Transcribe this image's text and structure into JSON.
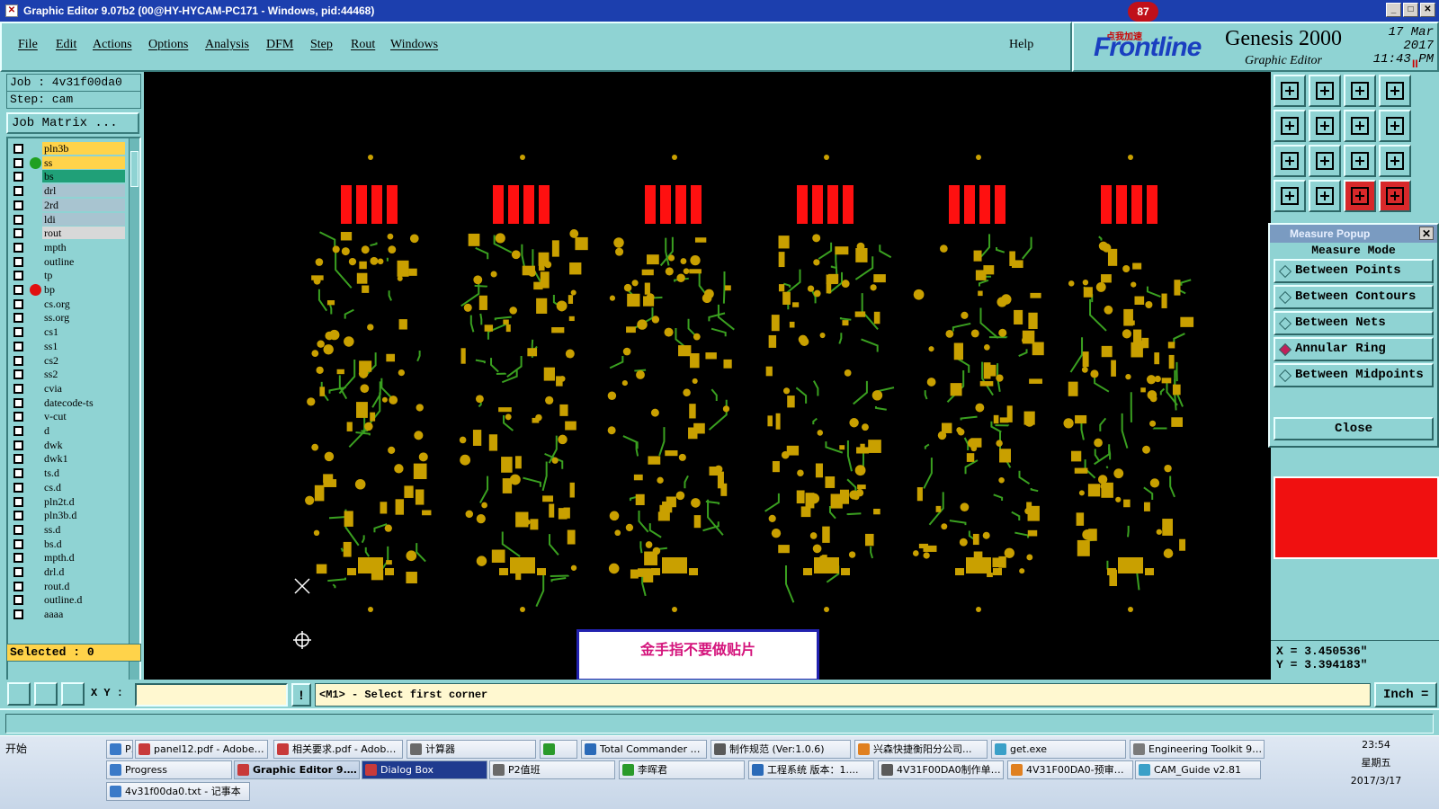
{
  "window": {
    "title": "Graphic Editor 9.07b2 (00@HY-HYCAM-PC171 - Windows, pid:44468)",
    "min": "_",
    "max": "□",
    "close": "✕"
  },
  "menu": [
    "File",
    "Edit",
    "Actions",
    "Options",
    "Analysis",
    "DFM",
    "Step",
    "Rout",
    "Windows"
  ],
  "help": "Help",
  "brand": {
    "logo": "Frontline",
    "product": "Genesis 2000",
    "subtitle": "Graphic Editor",
    "date": "17 Mar 2017",
    "time": "11:43 PM",
    "badge": "87",
    "badge_text": "点我加速",
    "pause": "II"
  },
  "job": {
    "job_line": "Job  :  4v31f00da0",
    "step_line": "Step:  cam"
  },
  "job_matrix": "Job Matrix ...",
  "layers": [
    {
      "name": "pln3b",
      "bg": "#ffd34a",
      "dot": ""
    },
    {
      "name": "ss",
      "bg": "#ffd34a",
      "dot": "#20a020"
    },
    {
      "name": "bs",
      "bg": "#20a078",
      "dot": ""
    },
    {
      "name": "drl",
      "bg": "#a8c4d0",
      "dot": ""
    },
    {
      "name": "2rd",
      "bg": "#a8c4d0",
      "dot": ""
    },
    {
      "name": "ldi",
      "bg": "#a8c4d0",
      "dot": ""
    },
    {
      "name": "rout",
      "bg": "#d8d8d8",
      "dot": ""
    },
    {
      "name": "mpth",
      "bg": "#8fd3d3",
      "dot": ""
    },
    {
      "name": "outline",
      "bg": "#8fd3d3",
      "dot": ""
    },
    {
      "name": "tp",
      "bg": "#8fd3d3",
      "dot": ""
    },
    {
      "name": "bp",
      "bg": "#8fd3d3",
      "dot": "#e01010"
    },
    {
      "name": "cs.org",
      "bg": "#8fd3d3",
      "dot": ""
    },
    {
      "name": "ss.org",
      "bg": "#8fd3d3",
      "dot": ""
    },
    {
      "name": "cs1",
      "bg": "#8fd3d3",
      "dot": ""
    },
    {
      "name": "ss1",
      "bg": "#8fd3d3",
      "dot": ""
    },
    {
      "name": "cs2",
      "bg": "#8fd3d3",
      "dot": ""
    },
    {
      "name": "ss2",
      "bg": "#8fd3d3",
      "dot": ""
    },
    {
      "name": "cvia",
      "bg": "#8fd3d3",
      "dot": ""
    },
    {
      "name": "datecode-ts",
      "bg": "#8fd3d3",
      "dot": ""
    },
    {
      "name": "v-cut",
      "bg": "#8fd3d3",
      "dot": ""
    },
    {
      "name": "d",
      "bg": "#8fd3d3",
      "dot": ""
    },
    {
      "name": "dwk",
      "bg": "#8fd3d3",
      "dot": ""
    },
    {
      "name": "dwk1",
      "bg": "#8fd3d3",
      "dot": ""
    },
    {
      "name": "ts.d",
      "bg": "#8fd3d3",
      "dot": ""
    },
    {
      "name": "cs.d",
      "bg": "#8fd3d3",
      "dot": ""
    },
    {
      "name": "pln2t.d",
      "bg": "#8fd3d3",
      "dot": ""
    },
    {
      "name": "pln3b.d",
      "bg": "#8fd3d3",
      "dot": ""
    },
    {
      "name": "ss.d",
      "bg": "#8fd3d3",
      "dot": ""
    },
    {
      "name": "bs.d",
      "bg": "#8fd3d3",
      "dot": ""
    },
    {
      "name": "mpth.d",
      "bg": "#8fd3d3",
      "dot": ""
    },
    {
      "name": "drl.d",
      "bg": "#8fd3d3",
      "dot": ""
    },
    {
      "name": "rout.d",
      "bg": "#8fd3d3",
      "dot": ""
    },
    {
      "name": "outline.d",
      "bg": "#8fd3d3",
      "dot": ""
    },
    {
      "name": "aaaa",
      "bg": "#8fd3d3",
      "dot": ""
    }
  ],
  "selected": "Selected : 0",
  "note": "金手指不要做贴片",
  "board": {
    "copper": "#c9a000",
    "trace": "#3aa020",
    "finger": "#ff1010",
    "count": 6
  },
  "measure": {
    "title": "Measure Popup",
    "mode_label": "Measure Mode",
    "options": [
      "Between Points",
      "Between Contours",
      "Between Nets",
      "Annular Ring",
      "Between Midpoints"
    ],
    "active_option": "Annular Ring",
    "close": "Close"
  },
  "coords": {
    "x": "X = 3.450536\"",
    "y": "Y = 3.394183\""
  },
  "cmd": {
    "xy_label": "X Y :",
    "prompt": "<M1> - Select first corner",
    "warn": "!",
    "unit": "Inch ="
  },
  "taskbar": {
    "start": "开始",
    "row1": [
      "Progress",
      "panel12.pdf - Adobe R...",
      "相关要求.pdf - Adobe ...",
      "计算器",
      "",
      "Total Commander 7.0 p...",
      "制作规范 (Ver:1.0.6)",
      "兴森快捷衡阳分公司...",
      "get.exe",
      "Engineering Toolkit 9.0..."
    ],
    "row2": [
      "Progress",
      "Graphic Editor 9.07...",
      "Dialog Box",
      "P2值班",
      "李晖君",
      "工程系统  版本：1....",
      "4V31F00DA0制作单....",
      "4V31F00DA0-预审指...",
      "CAM_Guide v2.81"
    ],
    "row3": [
      "4v31f00da0.txt - 记事本"
    ],
    "time": "23:54",
    "weekday": "星期五",
    "date": "2017/3/17"
  }
}
